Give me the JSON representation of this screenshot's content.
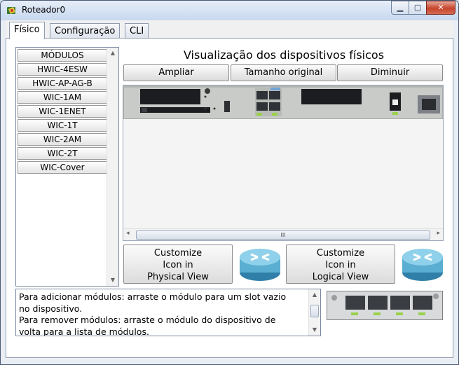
{
  "window": {
    "title": "Roteador0",
    "controls": {
      "minimize": "▁",
      "maximize": "▢",
      "close": "✕"
    }
  },
  "tabs": [
    {
      "label": "Físico",
      "active": true
    },
    {
      "label": "Configuração",
      "active": false
    },
    {
      "label": "CLI",
      "active": false
    }
  ],
  "modules": {
    "items": [
      "MÓDULOS",
      "HWIC-4ESW",
      "HWIC-AP-AG-B",
      "WIC-1AM",
      "WIC-1ENET",
      "WIC-1T",
      "WIC-2AM",
      "WIC-2T",
      "WIC-Cover"
    ]
  },
  "physical_view": {
    "title": "Visualização dos dispositivos físicos",
    "zoom_in": "Ampliar",
    "original_size": "Tamanho original",
    "zoom_out": "Diminuir",
    "scroll_thumb": "III"
  },
  "icon_buttons": {
    "physical": "Customize\nIcon in\nPhysical View",
    "logical": "Customize\nIcon in\nLogical View"
  },
  "info": {
    "text": "Para adicionar módulos: arraste o módulo para um slot vazio\n no dispositivo.\nPara remover módulos: arraste o módulo do dispositivo de\nvolta para a lista de módulos."
  },
  "colors": {
    "accent_green": "#9bd14a",
    "panel_gray": "#c8cbc8",
    "slot_dark": "#1b1d20"
  }
}
